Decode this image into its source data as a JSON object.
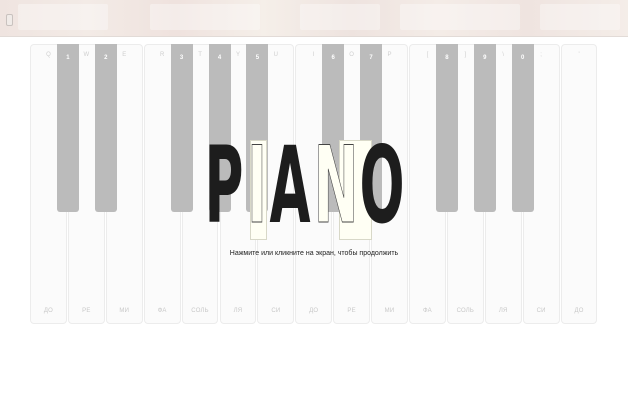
{
  "app": {
    "title": "PIANO",
    "hint": "Нажмите или кликните на экран, чтобы продолжить",
    "colors": {
      "background": "#ffffff",
      "white_key": "#fbfbfb",
      "black_key": "#bbbbbb",
      "title": "#1d1d1d",
      "ivory_letters": "#fffff4"
    }
  },
  "menu": {
    "icon": "menu-handle-icon"
  },
  "logo_letters": [
    "P",
    "I",
    "A",
    "N",
    "O"
  ],
  "white_keys": [
    {
      "kb": "Q",
      "note": "ДО"
    },
    {
      "kb": "W",
      "note": "РЕ"
    },
    {
      "kb": "E",
      "note": "МИ"
    },
    {
      "kb": "R",
      "note": "ФА"
    },
    {
      "kb": "T",
      "note": "СОЛЬ"
    },
    {
      "kb": "Y",
      "note": "ЛЯ"
    },
    {
      "kb": "U",
      "note": "СИ"
    },
    {
      "kb": "I",
      "note": "ДО"
    },
    {
      "kb": "O",
      "note": "РЕ"
    },
    {
      "kb": "P",
      "note": "МИ"
    },
    {
      "kb": "[",
      "note": "ФА"
    },
    {
      "kb": "]",
      "note": "СОЛЬ"
    },
    {
      "kb": "\\",
      "note": "ЛЯ"
    },
    {
      "kb": ";",
      "note": "СИ"
    },
    {
      "kb": "'",
      "note": "ДО"
    }
  ],
  "black_keys": [
    "1",
    "2",
    "3",
    "4",
    "5",
    "6",
    "7",
    "8",
    "9",
    "0"
  ]
}
